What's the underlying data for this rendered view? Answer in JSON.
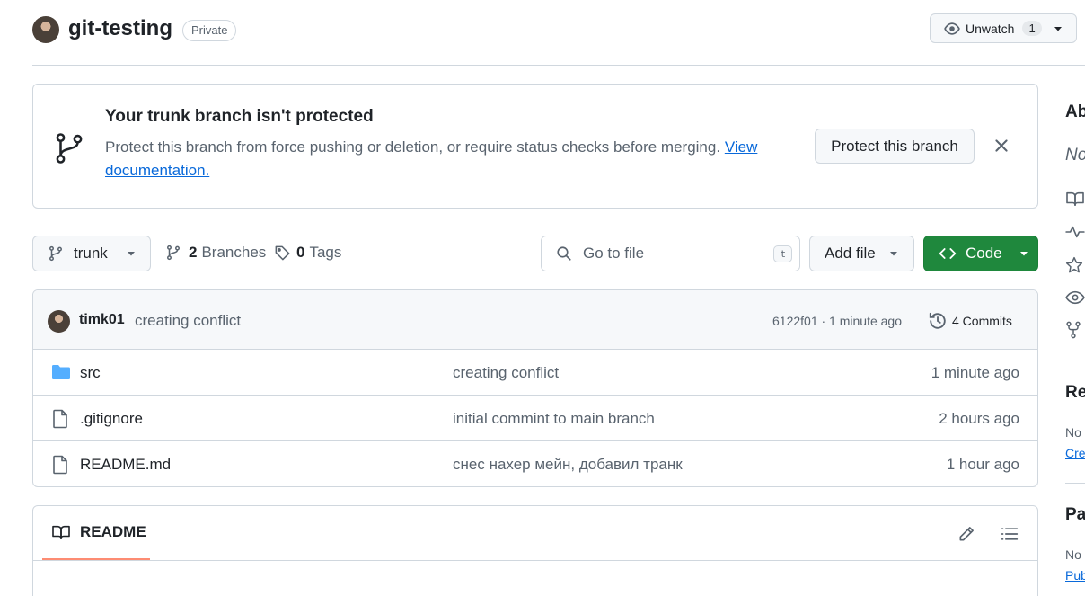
{
  "header": {
    "repo_name": "git-testing",
    "visibility": "Private",
    "watch": {
      "label": "Unwatch",
      "count": "1"
    }
  },
  "banner": {
    "title": "Your trunk branch isn't protected",
    "text": "Protect this branch from force pushing or deletion, or require status checks before merging.",
    "link": "View documentation.",
    "button": "Protect this branch"
  },
  "toolbar": {
    "branch": "trunk",
    "branches_count": "2",
    "branches_label": "Branches",
    "tags_count": "0",
    "tags_label": "Tags",
    "search_placeholder": "Go to file",
    "search_shortcut": "t",
    "add_file": "Add file",
    "code": "Code"
  },
  "latest_commit": {
    "author": "timk01",
    "message": "creating conflict",
    "meta": "6122f01 · 1 minute ago",
    "commits_label": "4 Commits"
  },
  "files": [
    {
      "type": "folder",
      "name": "src",
      "commit": "creating conflict",
      "time": "1 minute ago"
    },
    {
      "type": "file",
      "name": ".gitignore",
      "commit": "initial commint to main branch",
      "time": "2 hours ago"
    },
    {
      "type": "file",
      "name": "README.md",
      "commit": "снес нахер мейн, добавил транк",
      "time": "1 hour ago"
    }
  ],
  "readme": {
    "tab_label": "README"
  },
  "sidebar": {
    "about_title": "Ab",
    "description": "No",
    "releases_title": "Re",
    "releases_text": "No",
    "releases_link": "Cre",
    "packages_title": "Pa",
    "packages_text": "No",
    "packages_link": "Pub"
  },
  "colors": {
    "accent_green": "#1f883d",
    "link_blue": "#0969da",
    "folder_blue": "#54aeff",
    "tab_underline": "#fd8c73"
  }
}
